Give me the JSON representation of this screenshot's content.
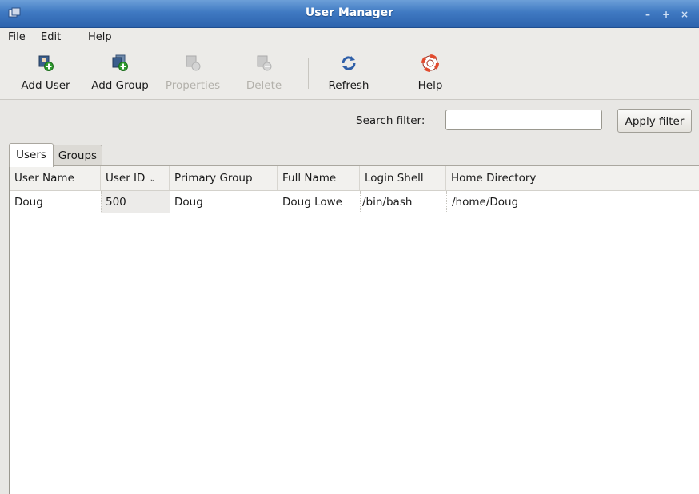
{
  "window": {
    "title": "User Manager",
    "buttons": [
      "–",
      "+",
      "×"
    ]
  },
  "menu": [
    {
      "label": "File"
    },
    {
      "label": "Edit"
    },
    {
      "label": "Help"
    }
  ],
  "toolbar": {
    "buttons": [
      {
        "label": "Add User",
        "icon": "add-user-icon",
        "enabled": true
      },
      {
        "label": "Add Group",
        "icon": "add-group-icon",
        "enabled": true
      },
      {
        "label": "Properties",
        "icon": "properties-icon",
        "enabled": false
      },
      {
        "label": "Delete",
        "icon": "delete-icon",
        "enabled": false
      },
      {
        "label": "Refresh",
        "icon": "refresh-icon",
        "enabled": true
      },
      {
        "label": "Help",
        "icon": "help-lifebuoy-icon",
        "enabled": true
      }
    ]
  },
  "search": {
    "label": "Search filter:",
    "value": "",
    "apply_label": "Apply filter"
  },
  "tabs": [
    {
      "label": "Users",
      "active": true
    },
    {
      "label": "Groups",
      "active": false
    }
  ],
  "table": {
    "columns": [
      "User Name",
      "User ID",
      "Primary Group",
      "Full Name",
      "Login Shell",
      "Home Directory"
    ],
    "sort_indicator": "⌄",
    "rows": [
      [
        "Doug",
        "500",
        "Doug",
        "Doug Lowe",
        "/bin/bash",
        "/home/Doug"
      ]
    ]
  },
  "colors": {
    "titlebar": "#3f79c2",
    "window_bg": "#e8e7e4",
    "add_badge": "#2e9b2e"
  }
}
